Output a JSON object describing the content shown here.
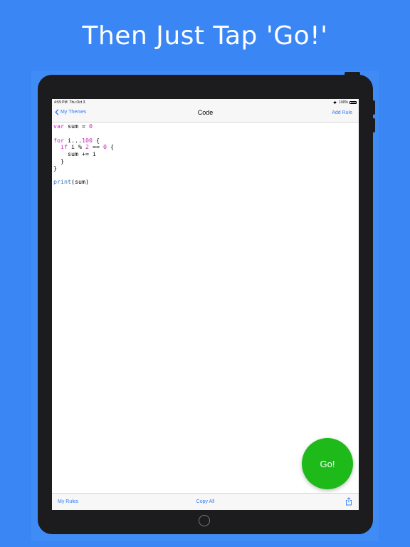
{
  "headline": "Then Just Tap 'Go!'",
  "status": {
    "time": "4:59 PM",
    "date": "Thu Oct 3",
    "battery": "100%"
  },
  "nav": {
    "back_label": "My Themes",
    "title": "Code",
    "right_label": "Add Rule"
  },
  "code": {
    "l1_kw": "var",
    "l1_rest": " sum = ",
    "l1_num": "0",
    "l3_kw": "for",
    "l3_rest": " i...",
    "l3_num": "100",
    "l3_end": " {",
    "l4_kw": "if",
    "l4_rest": " i % ",
    "l4_num1": "2",
    "l4_mid": " == ",
    "l4_num2": "0",
    "l4_end": " {",
    "l5": "    sum += i",
    "l6": "  }",
    "l7": "}",
    "l9_fn": "print",
    "l9_rest": "(sum)"
  },
  "go_label": "Go!",
  "toolbar": {
    "left_label": "My Rules",
    "center_label": "Copy All",
    "share_icon": "share-icon"
  },
  "colors": {
    "background": "#3b86f5",
    "accent": "#2f7cf6",
    "go": "#1dba1a",
    "keyword": "#c02fb5",
    "function": "#2a76c6"
  }
}
